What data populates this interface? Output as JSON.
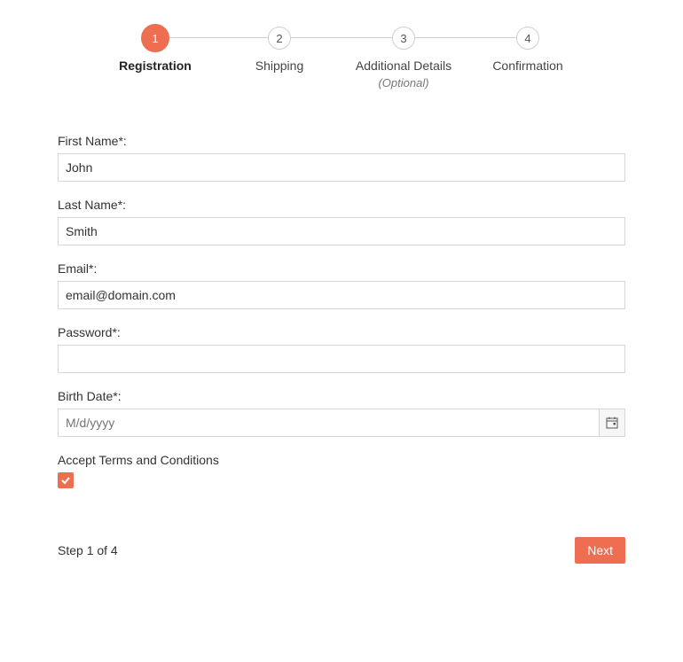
{
  "stepper": {
    "steps": [
      {
        "number": "1",
        "label": "Registration",
        "sublabel": "",
        "active": true
      },
      {
        "number": "2",
        "label": "Shipping",
        "sublabel": "",
        "active": false
      },
      {
        "number": "3",
        "label": "Additional Details",
        "sublabel": "(Optional)",
        "active": false
      },
      {
        "number": "4",
        "label": "Confirmation",
        "sublabel": "",
        "active": false
      }
    ]
  },
  "form": {
    "first_name": {
      "label": "First Name*:",
      "value": "John"
    },
    "last_name": {
      "label": "Last Name*:",
      "value": "Smith"
    },
    "email": {
      "label": "Email*:",
      "value": "email@domain.com"
    },
    "password": {
      "label": "Password*:",
      "value": ""
    },
    "birth_date": {
      "label": "Birth Date*:",
      "placeholder": "M/d/yyyy",
      "value": ""
    },
    "terms": {
      "label": "Accept Terms and Conditions",
      "checked": true
    }
  },
  "footer": {
    "step_text": "Step 1 of 4",
    "next_label": "Next"
  }
}
